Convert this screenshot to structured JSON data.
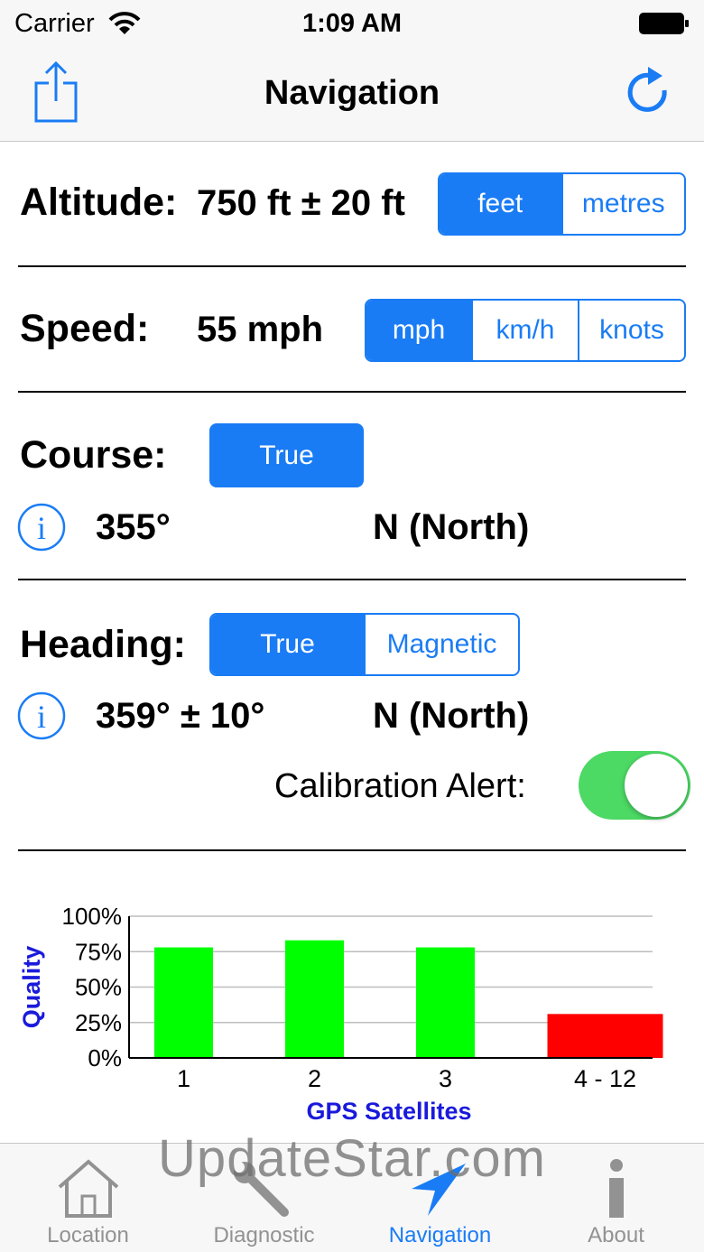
{
  "status_bar": {
    "carrier": "Carrier",
    "time": "1:09 AM"
  },
  "nav_bar": {
    "title": "Navigation",
    "left_icon": "share-icon",
    "right_icon": "refresh-icon"
  },
  "altitude": {
    "label": "Altitude:",
    "value": "750 ft ± 20 ft",
    "units": [
      "feet",
      "metres"
    ],
    "selected": "feet"
  },
  "speed": {
    "label": "Speed:",
    "value": "55 mph",
    "units": [
      "mph",
      "km/h",
      "knots"
    ],
    "selected": "mph"
  },
  "course": {
    "label": "Course:",
    "mode_button": "True",
    "value": "355°",
    "direction": "N (North)"
  },
  "heading": {
    "label": "Heading:",
    "modes": [
      "True",
      "Magnetic"
    ],
    "selected": "True",
    "value": "359° ± 10°",
    "direction": "N (North)"
  },
  "calibration": {
    "label": "Calibration Alert:",
    "enabled": true
  },
  "chart_data": {
    "type": "bar",
    "categories": [
      "1",
      "2",
      "3",
      "4 - 12"
    ],
    "values": [
      78,
      83,
      78,
      31
    ],
    "colors": [
      "#00ff00",
      "#00ff00",
      "#00ff00",
      "#ff0000"
    ],
    "ylim": [
      0,
      100
    ],
    "yticks": [
      "0%",
      "25%",
      "50%",
      "75%",
      "100%"
    ],
    "xlabel": "GPS Satellites",
    "ylabel": "Quality",
    "grid": true
  },
  "tab_bar": {
    "items": [
      {
        "label": "Location",
        "icon": "home-icon"
      },
      {
        "label": "Diagnostic",
        "icon": "wrench-icon"
      },
      {
        "label": "Navigation",
        "icon": "navigation-arrow-icon"
      },
      {
        "label": "About",
        "icon": "info-icon"
      }
    ],
    "active": "Navigation"
  },
  "watermark": "UpdateStar.com",
  "colors": {
    "accent": "#1a7cf5",
    "toggle_on": "#4cd964",
    "good": "#00ff00",
    "bad": "#ff0000",
    "axis_label": "#1a1adc"
  }
}
